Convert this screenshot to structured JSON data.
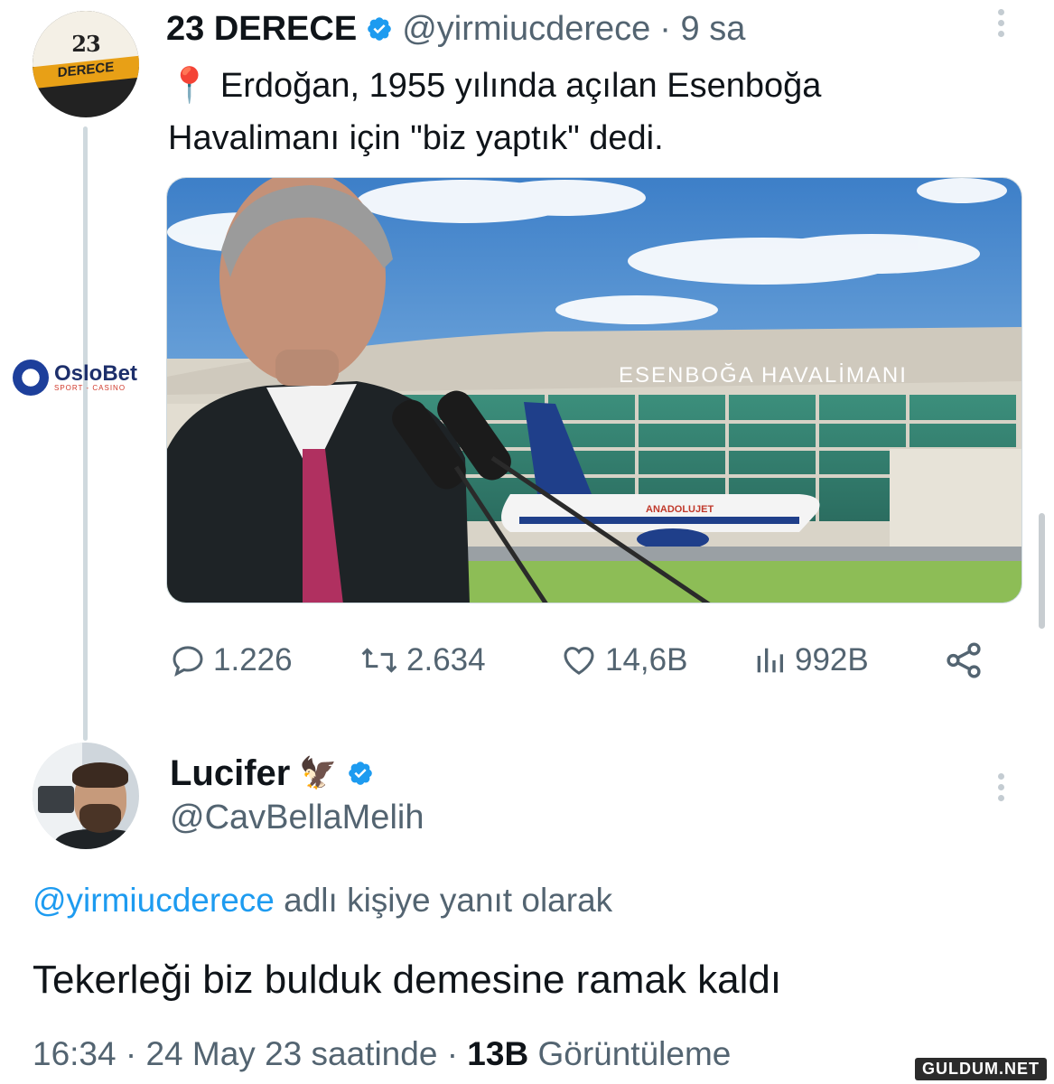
{
  "tweet": {
    "author_name": "23 DERECE",
    "author_handle": "@yirmiucderece",
    "time_ago": "· 9 sa",
    "avatar_text_top": "23",
    "avatar_text_bottom": "DERECE",
    "pin_emoji": "📍",
    "text_line1": "Erdoğan, 1955 yılında açılan Esenboğa",
    "text_line2": "Havalimanı için \"biz yaptık\" dedi.",
    "image_sign": "ESENBOĞA  HAVALİMANI",
    "image_plane_text": "ANADOLUJET",
    "stats": {
      "replies": "1.226",
      "retweets": "2.634",
      "likes": "14,6B",
      "views": "992B"
    }
  },
  "reply": {
    "author_name": "Lucifer",
    "author_emoji": "🦅",
    "author_handle": "@CavBellaMelih",
    "reply_to_handle": "@yirmiucderece",
    "reply_to_suffix": "adlı kişiye yanıt olarak",
    "text": "Tekerleği biz bulduk demesine ramak kaldı",
    "time": "16:34 · 24 May 23 saatinde ·",
    "views_count": "13B",
    "views_label": "Görüntüleme"
  },
  "watermarks": {
    "oslobet_name": "OsloBet",
    "oslobet_sub": "SPORT - CASINO",
    "site": "GULDUM.NET"
  },
  "colors": {
    "verified": "#1d9bf0",
    "secondary_text": "#536471",
    "link": "#1d9bf0",
    "primary_text": "#0f1419"
  }
}
